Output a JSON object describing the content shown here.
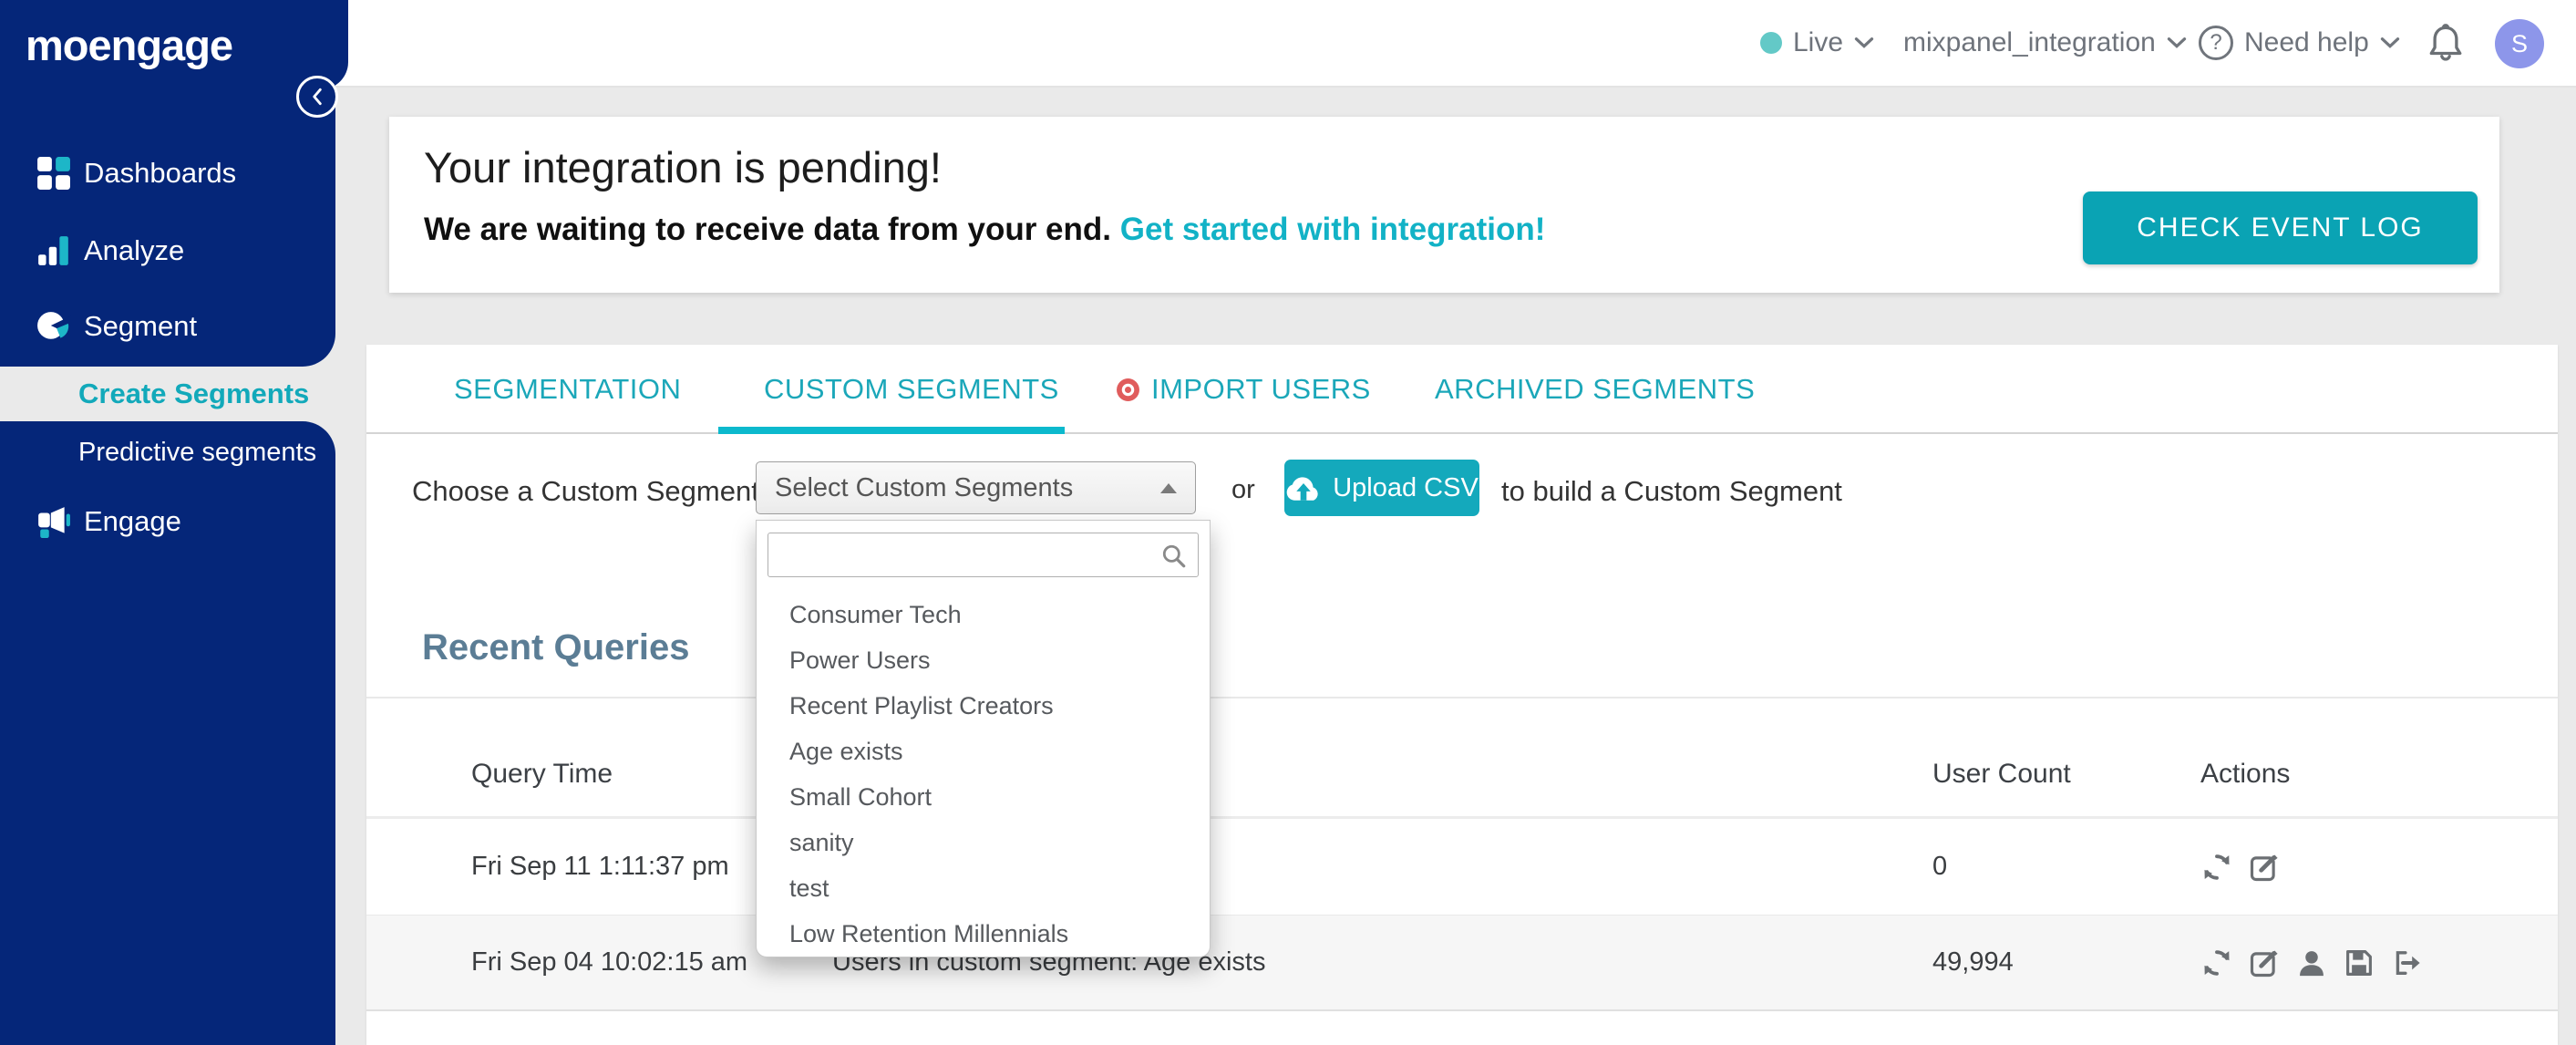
{
  "brand": {
    "logo_text": "moengage"
  },
  "topbar": {
    "env_label": "Live",
    "workspace": "mixpanel_integration",
    "help_label": "Need help",
    "avatar_initial": "S"
  },
  "icons": {
    "help_glyph": "?"
  },
  "sidebar": {
    "items": [
      {
        "label": "Dashboards",
        "icon": "grid-icon"
      },
      {
        "label": "Analyze",
        "icon": "bar-chart-icon"
      },
      {
        "label": "Segment",
        "icon": "pie-chart-icon"
      },
      {
        "label": "Create Segments",
        "active": true
      },
      {
        "label": "Predictive segments"
      },
      {
        "label": "Engage",
        "icon": "megaphone-icon"
      }
    ]
  },
  "banner": {
    "title": "Your integration is pending!",
    "subtitle": "We are waiting to receive data from your end.",
    "link_text": "Get started with integration!",
    "button_label": "CHECK EVENT LOG"
  },
  "tabs": [
    {
      "label": "SEGMENTATION",
      "active": false
    },
    {
      "label": "CUSTOM SEGMENTS",
      "active": true
    },
    {
      "label": "IMPORT USERS",
      "active": false,
      "dot_icon": "record-dot-icon"
    },
    {
      "label": "ARCHIVED SEGMENTS",
      "active": false
    }
  ],
  "chooser": {
    "label": "Choose a Custom Segment:",
    "select_value": "Select Custom Segments",
    "or_text": "or",
    "upload_label": "Upload CSV",
    "suffix": "to build a Custom Segment",
    "search_value": ""
  },
  "dropdown": {
    "items": [
      "Consumer Tech",
      "Power Users",
      "Recent Playlist Creators",
      "Age exists",
      "Small Cohort",
      "sanity",
      "test",
      "Low Retention Millennials"
    ]
  },
  "table": {
    "heading": "Recent Queries",
    "columns": [
      "Query Time",
      "",
      "User Count",
      "Actions"
    ],
    "rows": [
      {
        "time": "Fri Sep 11 1:11:37 pm",
        "description": "",
        "user_count": "0",
        "actions": [
          "refresh",
          "edit"
        ]
      },
      {
        "time": "Fri Sep 04 10:02:15 am",
        "description": "Users in custom segment: Age exists",
        "user_count": "49,994",
        "actions": [
          "refresh",
          "edit",
          "user",
          "save",
          "export"
        ]
      }
    ]
  },
  "colors": {
    "sidebar_navy": "#052679",
    "accent_teal": "#12A9BC",
    "button_teal": "#0AA3B4",
    "tab_underline": "#0CB9CD",
    "link_teal": "#12B2C6",
    "heading_slate": "#5B7D95",
    "live_dot": "#63C9C7",
    "avatar_bg": "#8D96EA",
    "import_dot_red": "#E05C5C"
  }
}
